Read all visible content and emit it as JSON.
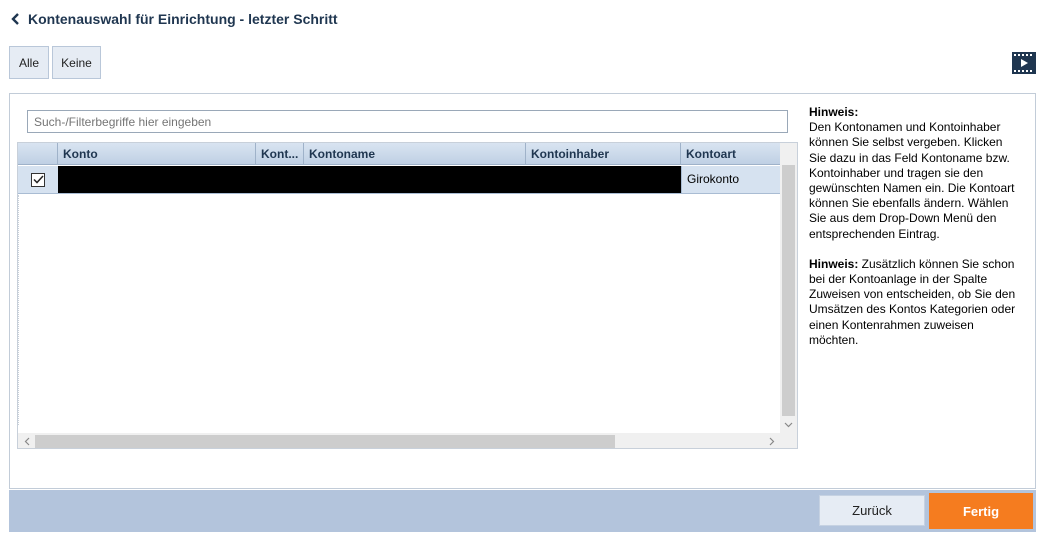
{
  "header": {
    "title": "Kontenauswahl für Einrichtung - letzter Schritt"
  },
  "toolbar": {
    "all_label": "Alle",
    "none_label": "Keine"
  },
  "search": {
    "placeholder": "Such-/Filterbegriffe hier eingeben"
  },
  "grid": {
    "columns": [
      "Konto",
      "Kont...",
      "Kontoname",
      "Kontoinhaber",
      "Kontoart"
    ],
    "rows": [
      {
        "checked": true,
        "konto": "",
        "kontonummer": "",
        "kontoname": "",
        "kontoinhaber": "",
        "kontoart": "Girokonto",
        "redacted": true
      }
    ]
  },
  "hints": {
    "hint1_label": "Hinweis:",
    "hint1_text": "Den Kontonamen und Kontoinhaber können Sie selbst vergeben. Klicken Sie dazu in das Feld Kontoname bzw. Kontoinhaber und tragen sie den gewünschten Namen ein. Die Kontoart können Sie ebenfalls ändern. Wählen Sie aus dem Drop-Down Menü den entsprechenden Eintrag.",
    "hint2_label": "Hinweis:",
    "hint2_text": " Zusätzlich können Sie schon bei der Kontoanlage in der Spalte Zuweisen von entscheiden, ob Sie den Umsätzen des Kontos Kategorien oder einen Kontenrahmen zuweisen möchten."
  },
  "footer": {
    "back_label": "Zurück",
    "finish_label": "Fertig"
  },
  "colors": {
    "accent": "#f57c1f",
    "title": "#1f3650",
    "footer_bg": "#b3c4dc",
    "header_bg": "#c9d7e8"
  }
}
